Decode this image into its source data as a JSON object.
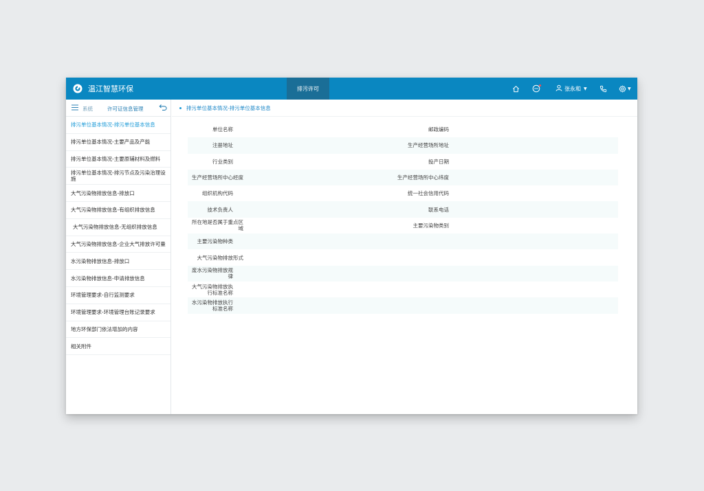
{
  "header": {
    "brand": "温江智慧环保",
    "nav_tab": "排污许可",
    "user_name": "张永和",
    "icons": [
      "home-icon",
      "message-icon",
      "user-icon",
      "phone-icon",
      "settings-icon"
    ],
    "accent": "#0a87c1"
  },
  "sidebar": {
    "system_label": "系统",
    "current_label": "许可证信息管理",
    "items": [
      "排污单位基本情况-排污单位基本信息",
      "排污单位基本情况-主要产品及产能",
      "排污单位基本情况-主要原辅材料及燃料",
      "排污单位基本情况-排污节点及污染治理设施",
      "大气污染物排放信息-排放口",
      "大气污染物排放信息-有组织排放信息",
      "大气污染物排放信息-无组织排放信息",
      "大气污染物排放信息-企业大气排放许可量",
      "水污染物排放信息-排放口",
      "水污染物排放信息-申请排放信息",
      "环境管理要求-自行监测要求",
      "环境管理要求-环境管理台账记录要求",
      "地方环保部门依法增加的内容",
      "相关附件"
    ]
  },
  "content": {
    "breadcrumb": "排污单位基本情况-排污单位基本信息",
    "rows": [
      {
        "left": "单位名称",
        "right": "邮政编码"
      },
      {
        "left": "注册地址",
        "right": "生产经营场所地址"
      },
      {
        "left": "行业类别",
        "right": "投产日期"
      },
      {
        "left": "生产经营场所中心经度",
        "right": "生产经营场所中心纬度"
      },
      {
        "left": "组织机构代码",
        "right": "统一社会信用代码"
      },
      {
        "left": "技术负责人",
        "right": "联系电话"
      },
      {
        "left": "所在地是否属于重点区域",
        "right": "主要污染物类别"
      },
      {
        "left": "主要污染物种类",
        "right": ""
      },
      {
        "left": "大气污染物排放形式",
        "right": ""
      },
      {
        "left": "废水污染物排放规律",
        "right": ""
      },
      {
        "left": "大气污染物排放执行标准名称",
        "right": ""
      },
      {
        "left": "水污染物排放执行标准名称",
        "right": ""
      }
    ]
  }
}
